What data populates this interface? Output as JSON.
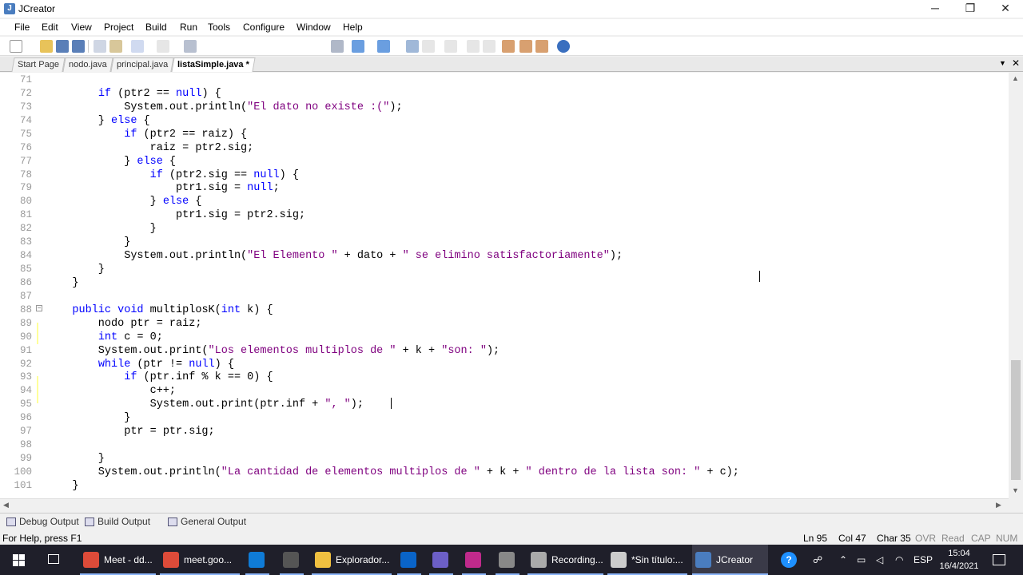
{
  "window": {
    "title": "JCreator",
    "minimize": "─",
    "maximize": "❐",
    "close": "✕"
  },
  "menu": [
    "File",
    "Edit",
    "View",
    "Project",
    "Build",
    "Run",
    "Tools",
    "Configure",
    "Window",
    "Help"
  ],
  "tabs": [
    {
      "label": "Start Page",
      "active": false
    },
    {
      "label": "nodo.java",
      "active": false
    },
    {
      "label": "principal.java",
      "active": false
    },
    {
      "label": "listaSimple.java *",
      "active": true
    }
  ],
  "code": [
    {
      "n": "71",
      "t": ""
    },
    {
      "n": "72",
      "t": "        if (ptr2 == null) {"
    },
    {
      "n": "73",
      "t": "            System.out.println(\"El dato no existe :(\");"
    },
    {
      "n": "74",
      "t": "        } else {"
    },
    {
      "n": "75",
      "t": "            if (ptr2 == raiz) {"
    },
    {
      "n": "76",
      "t": "                raiz = ptr2.sig;"
    },
    {
      "n": "77",
      "t": "            } else {"
    },
    {
      "n": "78",
      "t": "                if (ptr2.sig == null) {"
    },
    {
      "n": "79",
      "t": "                    ptr1.sig = null;"
    },
    {
      "n": "80",
      "t": "                } else {"
    },
    {
      "n": "81",
      "t": "                    ptr1.sig = ptr2.sig;"
    },
    {
      "n": "82",
      "t": "                }"
    },
    {
      "n": "83",
      "t": "            }"
    },
    {
      "n": "84",
      "t": "            System.out.println(\"El Elemento \" + dato + \" se elimino satisfactoriamente\");"
    },
    {
      "n": "85",
      "t": "        }"
    },
    {
      "n": "86",
      "t": "    }"
    },
    {
      "n": "87",
      "t": ""
    },
    {
      "n": "88",
      "t": "    public void multiplosK(int k) {"
    },
    {
      "n": "89",
      "t": "        nodo ptr = raiz;"
    },
    {
      "n": "90",
      "t": "        int c = 0;"
    },
    {
      "n": "91",
      "t": "        System.out.print(\"Los elementos multiplos de \" + k + \"son: \");"
    },
    {
      "n": "92",
      "t": "        while (ptr != null) {"
    },
    {
      "n": "93",
      "t": "            if (ptr.inf % k == 0) {"
    },
    {
      "n": "94",
      "t": "                c++;"
    },
    {
      "n": "95",
      "t": "                System.out.print(ptr.inf + \", \");"
    },
    {
      "n": "96",
      "t": "            }"
    },
    {
      "n": "97",
      "t": "            ptr = ptr.sig;"
    },
    {
      "n": "98",
      "t": ""
    },
    {
      "n": "99",
      "t": "        }"
    },
    {
      "n": "100",
      "t": "        System.out.println(\"La cantidad de elementos multiplos de \" + k + \" dentro de la lista son: \" + c);"
    },
    {
      "n": "101",
      "t": "    }"
    }
  ],
  "output_tabs": [
    "Debug Output",
    "Build Output",
    "General Output"
  ],
  "status": {
    "help": "For Help, press F1",
    "ln": "Ln 95",
    "col": "Col 47",
    "char": "Char 35",
    "ovr": "OVR",
    "read": "Read",
    "cap": "CAP",
    "num": "NUM"
  },
  "taskbar": {
    "items": [
      {
        "label": "Meet - dd...",
        "color": "#dd4b39"
      },
      {
        "label": "meet.goo...",
        "color": "#dd4b39"
      },
      {
        "label": "",
        "color": "#0f7bd6"
      },
      {
        "label": "",
        "color": "#555"
      },
      {
        "label": "Explorador...",
        "color": "#f0c040"
      },
      {
        "label": "",
        "color": "#0a64c8"
      },
      {
        "label": "",
        "color": "#6c5fc7"
      },
      {
        "label": "",
        "color": "#c02a8c"
      },
      {
        "label": "",
        "color": "#888"
      },
      {
        "label": "Recording...",
        "color": "#aaa"
      },
      {
        "label": "*Sin título:...",
        "color": "#ccc"
      },
      {
        "label": "JCreator",
        "color": "#4a7dbf"
      }
    ],
    "lang": "ESP",
    "time": "15:04",
    "date": "16/4/2021"
  }
}
